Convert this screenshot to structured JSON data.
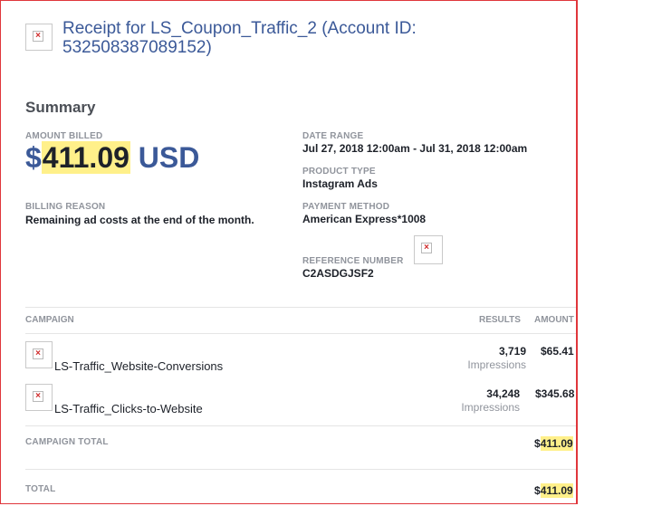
{
  "header": {
    "title": "Receipt for LS_Coupon_Traffic_2 (Account ID: 532508387089152)"
  },
  "summary": {
    "heading": "Summary",
    "amount_billed_label": "AMOUNT BILLED",
    "amount_currency_symbol": "$",
    "amount_value": "411.09",
    "amount_currency_code": "USD",
    "billing_reason_label": "BILLING REASON",
    "billing_reason": "Remaining ad costs at the end of the month.",
    "date_range_label": "DATE RANGE",
    "date_range": "Jul 27, 2018 12:00am - Jul 31, 2018 12:00am",
    "product_type_label": "PRODUCT TYPE",
    "product_type": "Instagram Ads",
    "payment_method_label": "PAYMENT METHOD",
    "payment_method": "American Express*1008",
    "reference_number_label": "REFERENCE NUMBER",
    "reference_number": "C2ASDGJSF2"
  },
  "table": {
    "headers": {
      "campaign": "CAMPAIGN",
      "results": "RESULTS",
      "amount": "AMOUNT"
    },
    "rows": [
      {
        "name": "LS-Traffic_Website-Conversions",
        "results": "3,719",
        "results_unit": "Impressions",
        "amount": "$65.41"
      },
      {
        "name": "LS-Traffic_Clicks-to-Website",
        "results": "34,248",
        "results_unit": "Impressions",
        "amount": "$345.68"
      }
    ],
    "campaign_total_label": "CAMPAIGN TOTAL",
    "campaign_total_symbol": "$",
    "campaign_total_value": "411.09",
    "total_label": "TOTAL",
    "total_symbol": "$",
    "total_value": "411.09"
  },
  "colors": {
    "brand": "#3b5998",
    "highlight": "#fff08a",
    "border": "#e0363b"
  }
}
